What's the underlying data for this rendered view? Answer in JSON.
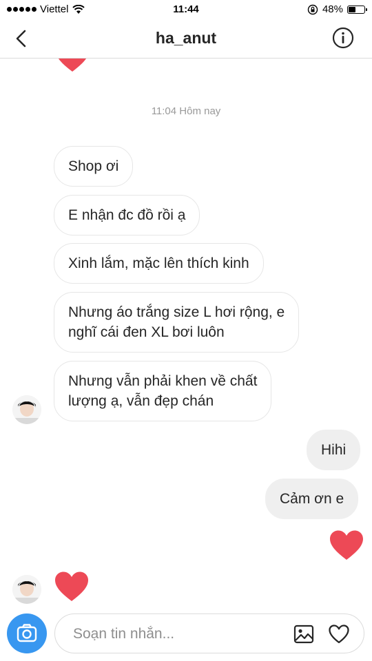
{
  "status_bar": {
    "carrier": "Viettel",
    "time": "11:44",
    "battery": "48%",
    "battery_level": 0.48
  },
  "header": {
    "title": "ha_anut",
    "back_icon": "chevron-left-icon",
    "info_icon": "info-icon"
  },
  "conversation": {
    "timestamp": "11:04 Hôm nay",
    "incoming_messages": [
      {
        "text": "Shop ơi"
      },
      {
        "text": "E nhận đc đồ rồi ạ"
      },
      {
        "text": "Xinh lắm, mặc lên thích kinh"
      },
      {
        "line1": "Nhưng áo trắng size L hơi rộng, e",
        "line2": "nghĩ cái đen XL bơi luôn"
      },
      {
        "line1": "Nhưng vẫn phải khen về chất",
        "line2": "lượng ạ, vẫn đẹp chán"
      }
    ],
    "outgoing_messages": [
      {
        "text": "Hihi"
      },
      {
        "text": "Cảm ơn e"
      }
    ]
  },
  "composer": {
    "placeholder": "Soạn tin nhắn...",
    "camera_icon": "camera-icon",
    "gallery_icon": "gallery-icon",
    "like_icon": "heart-outline-icon"
  },
  "colors": {
    "heart": "#ed4956",
    "camera": "#3897f0",
    "outgoing_bubble": "#efefef"
  }
}
